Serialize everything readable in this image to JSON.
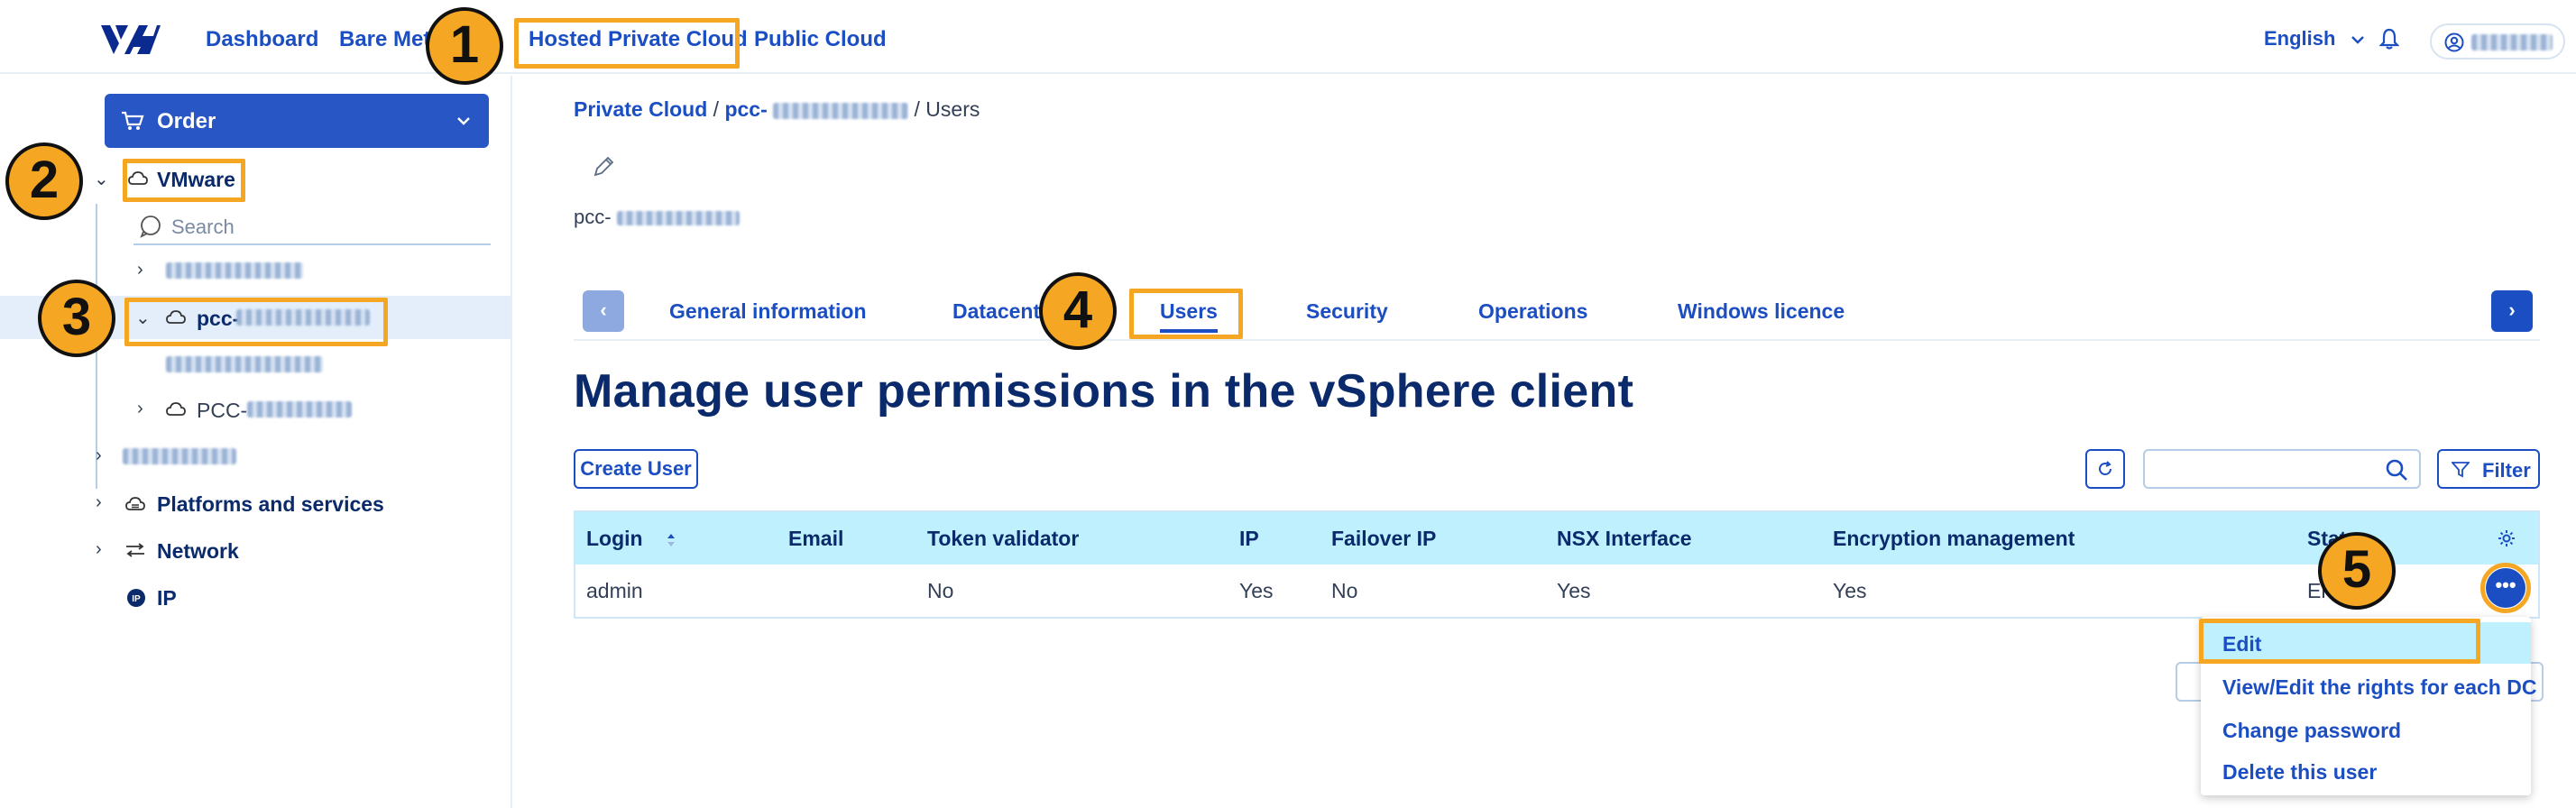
{
  "topnav": {
    "items": [
      "Dashboard",
      "Bare Metal",
      "Hosted Private Cloud",
      "Public Cloud"
    ],
    "language": "English"
  },
  "sidebar": {
    "order_label": "Order",
    "root_label": "VMware",
    "search_placeholder": "Search",
    "selected_prefix": "pcc-",
    "pcc_prefix": "PCC-",
    "platforms_label": "Platforms and services",
    "network_label": "Network",
    "ip_label": "IP"
  },
  "breadcrumb": {
    "root": "Private Cloud",
    "service_prefix": "pcc-",
    "current": "Users"
  },
  "service": {
    "name_prefix": "pcc-"
  },
  "tabs": [
    "General information",
    "Datacentres",
    "Users",
    "Security",
    "Operations",
    "Windows licence"
  ],
  "main": {
    "title": "Manage user permissions in the vSphere client",
    "create_user": "Create User",
    "filter": "Filter"
  },
  "table": {
    "columns": [
      "Login",
      "Email",
      "Token validator",
      "IP",
      "Failover IP",
      "NSX Interface",
      "Encryption management",
      "Status"
    ],
    "rows": [
      {
        "login": "admin",
        "email": "",
        "token_validator": "No",
        "ip": "Yes",
        "failover_ip": "No",
        "nsx": "Yes",
        "encryption": "Yes",
        "status": "Enabled"
      }
    ]
  },
  "action_menu": {
    "items": [
      "Edit",
      "View/Edit the rights for each DC",
      "Change password",
      "Delete this user"
    ]
  },
  "annotations": {
    "steps": [
      "1",
      "2",
      "3",
      "4",
      "5"
    ],
    "color": "#f5a623"
  },
  "colors": {
    "brand_blue": "#1b4ec2",
    "header_cyan": "#bef1fd",
    "navy_text": "#0a2a6b"
  }
}
